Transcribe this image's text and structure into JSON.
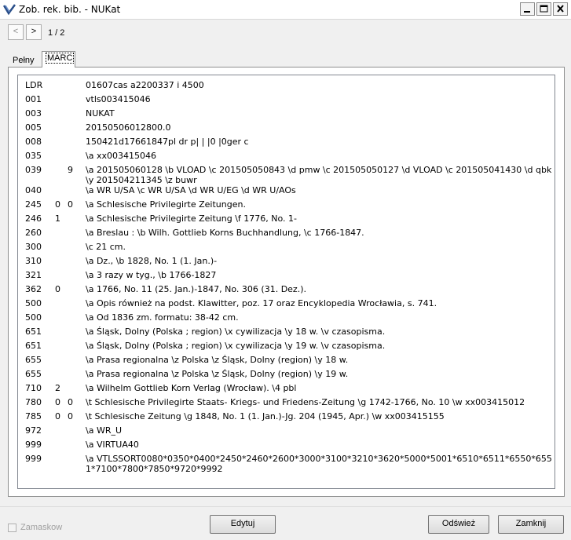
{
  "window": {
    "title": "Zob. rek. bib. - NUKat",
    "controls": {
      "min_icon": "minimize-icon",
      "max_icon": "maximize-icon",
      "close_icon": "close-icon"
    }
  },
  "nav": {
    "prev_label": "<",
    "next_label": ">",
    "page_count": "1 / 2"
  },
  "tabs": [
    {
      "label": "Pełny",
      "active": false
    },
    {
      "label": "MARC",
      "active": true
    }
  ],
  "marc": {
    "rows": [
      {
        "tag": "LDR",
        "ind1": "",
        "ind2": "",
        "value": "01607cas a2200337 i 4500"
      },
      {
        "tag": "001",
        "ind1": "",
        "ind2": "",
        "value": "vtls003415046"
      },
      {
        "tag": "003",
        "ind1": "",
        "ind2": "",
        "value": "NUKAT"
      },
      {
        "tag": "005",
        "ind1": "",
        "ind2": "",
        "value": "20150506012800.0"
      },
      {
        "tag": "008",
        "ind1": "",
        "ind2": "",
        "value": "150421d17661847pl dr p|  |  |0   |0ger c"
      },
      {
        "tag": "035",
        "ind1": "",
        "ind2": "",
        "value": "\\a xx003415046"
      },
      {
        "tag": "039",
        "ind1": "",
        "ind2": "9",
        "value": "\\a 201505060128 \\b VLOAD \\c 201505050843 \\d pmw \\c 201505050127 \\d VLOAD \\c 201505041430 \\d qbk \\y 201504211345 \\z buwr"
      },
      {
        "tag": "040",
        "ind1": "",
        "ind2": "",
        "value": "\\a WR U/SA \\c WR U/SA \\d WR U/EG \\d WR U/AOs"
      },
      {
        "tag": "245",
        "ind1": "0",
        "ind2": "0",
        "value": "\\a Schlesische Privilegirte Zeitungen."
      },
      {
        "tag": "246",
        "ind1": "1",
        "ind2": "",
        "value": "\\a Schlesische Privilegirte Zeitung \\f 1776, No. 1-"
      },
      {
        "tag": "260",
        "ind1": "",
        "ind2": "",
        "value": "\\a Breslau : \\b Wilh. Gottlieb Korns Buchhandlung, \\c 1766-1847."
      },
      {
        "tag": "300",
        "ind1": "",
        "ind2": "",
        "value": "\\c 21 cm."
      },
      {
        "tag": "310",
        "ind1": "",
        "ind2": "",
        "value": "\\a Dz., \\b 1828, No. 1 (1. Jan.)-"
      },
      {
        "tag": "321",
        "ind1": "",
        "ind2": "",
        "value": "\\a 3 razy w tyg., \\b 1766-1827"
      },
      {
        "tag": "362",
        "ind1": "0",
        "ind2": "",
        "value": "\\a 1766, No. 11 (25. Jan.)-1847, No. 306 (31. Dez.)."
      },
      {
        "tag": "500",
        "ind1": "",
        "ind2": "",
        "value": "\\a Opis również na podst. Klawitter, poz. 17 oraz Encyklopedia Wrocławia, s. 741."
      },
      {
        "tag": "500",
        "ind1": "",
        "ind2": "",
        "value": "\\a Od 1836 zm. formatu: 38-42 cm."
      },
      {
        "tag": "651",
        "ind1": "",
        "ind2": "",
        "value": "\\a Śląsk, Dolny (Polska ; region) \\x cywilizacja \\y 18 w. \\v czasopisma."
      },
      {
        "tag": "651",
        "ind1": "",
        "ind2": "",
        "value": "\\a Śląsk, Dolny (Polska ; region) \\x cywilizacja \\y 19 w. \\v czasopisma."
      },
      {
        "tag": "655",
        "ind1": "",
        "ind2": "",
        "value": "\\a Prasa regionalna \\z Polska \\z Śląsk, Dolny (region) \\y 18 w."
      },
      {
        "tag": "655",
        "ind1": "",
        "ind2": "",
        "value": "\\a Prasa regionalna \\z Polska \\z Śląsk, Dolny (region) \\y 19 w."
      },
      {
        "tag": "710",
        "ind1": "2",
        "ind2": "",
        "value": "\\a Wilhelm Gottlieb Korn Verlag (Wrocław). \\4 pbl"
      },
      {
        "tag": "780",
        "ind1": "0",
        "ind2": "0",
        "value": "\\t Schlesische Privilegirte Staats- Kriegs- und Friedens-Zeitung \\g 1742-1766, No. 10 \\w xx003415012"
      },
      {
        "tag": "785",
        "ind1": "0",
        "ind2": "0",
        "value": "\\t Schlesische Zeitung \\g 1848, No. 1 (1. Jan.)-Jg. 204 (1945, Apr.) \\w xx003415155"
      },
      {
        "tag": "972",
        "ind1": "",
        "ind2": "",
        "value": "\\a WR_U"
      },
      {
        "tag": "999",
        "ind1": "",
        "ind2": "",
        "value": "\\a VIRTUA40"
      },
      {
        "tag": "999",
        "ind1": "",
        "ind2": "",
        "value": "\\a VTLSSORT0080*0350*0400*2450*2460*2600*3000*3100*3210*3620*5000*5001*6510*6511*6550*6551*7100*7800*7850*9720*9992"
      }
    ]
  },
  "footer": {
    "mask_label": "Zamaskow",
    "edit_label": "Edytuj",
    "refresh_label": "Odśwież",
    "close_label": "Zamknij"
  }
}
